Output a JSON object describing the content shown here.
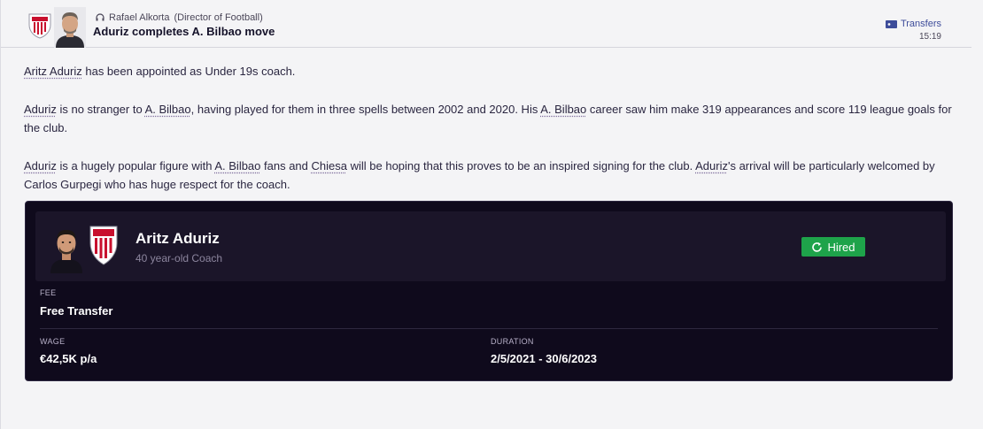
{
  "header": {
    "sender_name": "Rafael Alkorta",
    "sender_role": "(Director of Football)",
    "headline": "Aduriz completes A. Bilbao move",
    "tag": "Transfers",
    "time": "15:19"
  },
  "body": {
    "p1": [
      "Aritz Aduriz",
      " has been appointed as Under 19s coach."
    ],
    "p2": [
      "Aduriz",
      " is no stranger to ",
      "A. Bilbao",
      ", having played for them in three spells between 2002 and 2020. His ",
      "A. Bilbao",
      " career saw him make 319 appearances and score 119 league goals for the club."
    ],
    "p3": [
      "Aduriz",
      " is a hugely popular figure with ",
      "A. Bilbao",
      " fans and ",
      "Chiesa",
      " will be hoping that this proves to be an inspired signing for the club. ",
      "Aduriz",
      "'s arrival will be particularly welcomed by Carlos Gurpegi who has huge respect for the coach."
    ]
  },
  "card": {
    "name": "Aritz Aduriz",
    "subtitle": "40 year-old Coach",
    "status": "Hired",
    "fee_label": "FEE",
    "fee_value": "Free Transfer",
    "wage_label": "WAGE",
    "wage_value": "€42,5K p/a",
    "duration_label": "DURATION",
    "duration_value": "2/5/2021 - 30/6/2023"
  },
  "colors": {
    "accent": "#3d4c9a",
    "card_bg": "#0f0a1c",
    "hired": "#1ea34a"
  },
  "icons": {
    "crest": "athletic-bilbao-crest-icon",
    "headset": "headset-icon",
    "tag": "tag-icon",
    "refresh": "refresh-icon"
  }
}
